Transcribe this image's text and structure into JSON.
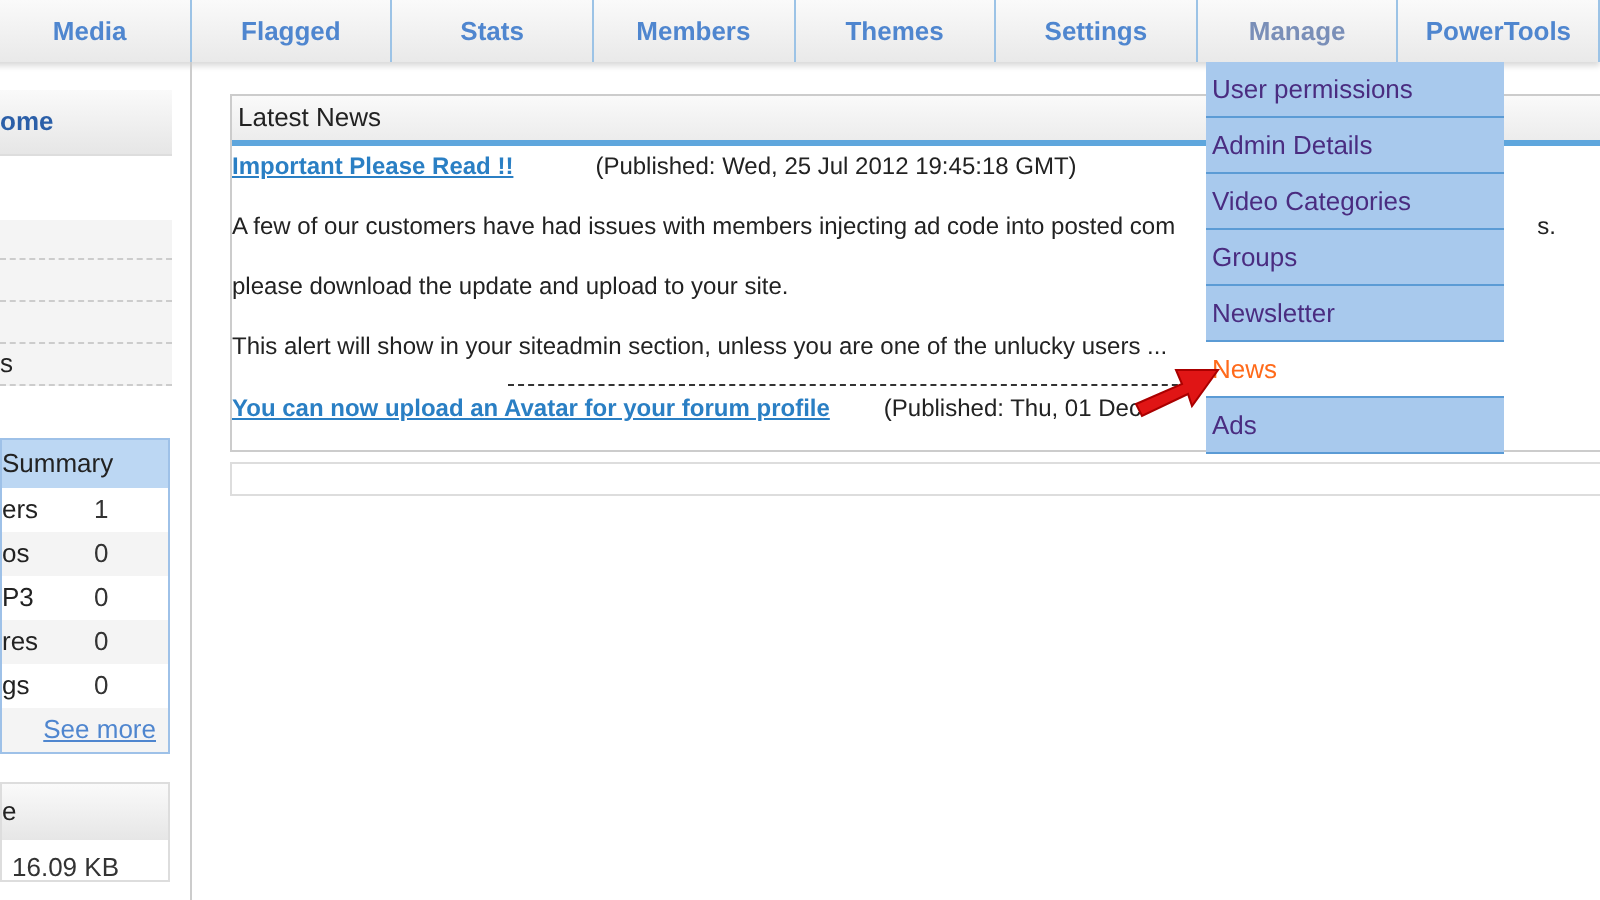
{
  "nav": {
    "tabs": [
      {
        "label": "Media",
        "selected": false
      },
      {
        "label": "Flagged",
        "selected": false
      },
      {
        "label": "Stats",
        "selected": false
      },
      {
        "label": "Members",
        "selected": false
      },
      {
        "label": "Themes",
        "selected": false
      },
      {
        "label": "Settings",
        "selected": false
      },
      {
        "label": "Manage",
        "selected": true
      },
      {
        "label": "PowerTools",
        "selected": false
      }
    ]
  },
  "manage_menu": {
    "items": [
      {
        "label": "User permissions",
        "selected": false
      },
      {
        "label": "Admin Details",
        "selected": false
      },
      {
        "label": "Video Categories",
        "selected": false
      },
      {
        "label": "Groups",
        "selected": false
      },
      {
        "label": "Newsletter",
        "selected": false
      },
      {
        "label": "News",
        "selected": true
      },
      {
        "label": "Ads",
        "selected": false
      }
    ]
  },
  "sidebar": {
    "header": "ome",
    "items": [
      "s"
    ],
    "summary": {
      "title": "Summary",
      "rows": [
        {
          "label": "ers",
          "value": "1"
        },
        {
          "label": "os",
          "value": "0"
        },
        {
          "label": "P3",
          "value": "0"
        },
        {
          "label": "res",
          "value": "0"
        },
        {
          "label": "gs",
          "value": "0"
        }
      ],
      "link": "See more"
    },
    "storage": {
      "title": "e",
      "value": "16.09 KB"
    }
  },
  "news": {
    "title": "Latest News",
    "items": [
      {
        "headline": "Important Please Read !!",
        "published": "(Published: Wed, 25 Jul 2012 19:45:18 GMT)",
        "paragraphs": [
          {
            "start": "A few of our customers have had issues with members injecting ad code into posted com",
            "end": "s."
          },
          {
            "start": "please download the update and upload to your site."
          },
          {
            "start": "This alert will show in your siteadmin section, unless you are one of the unlucky users ..."
          }
        ]
      },
      {
        "headline": "You can now upload an Avatar for your forum profile",
        "published": "(Published: Thu, 01 Dec"
      }
    ]
  }
}
